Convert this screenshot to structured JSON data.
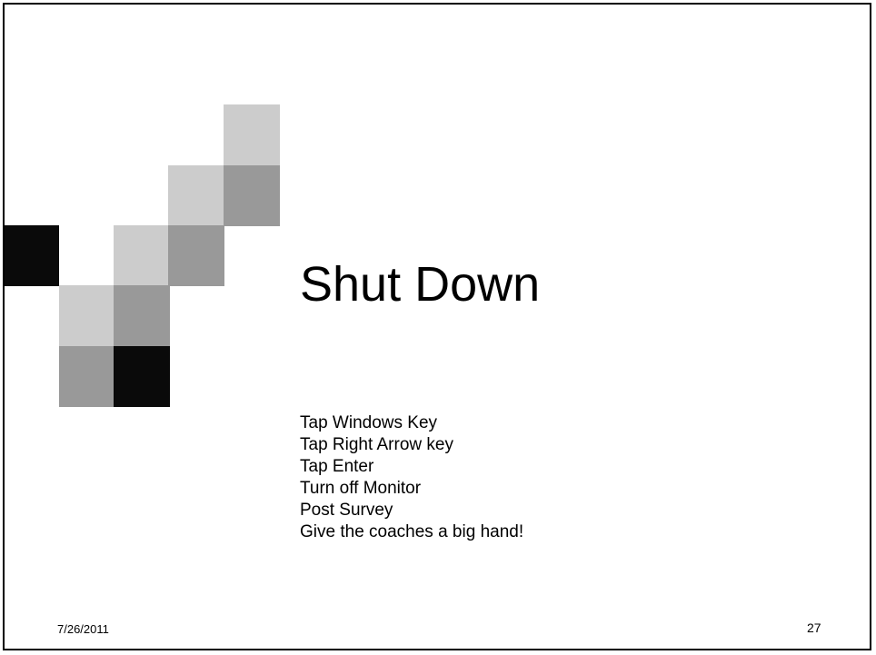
{
  "slide": {
    "title": "Shut Down",
    "bullets": [
      "Tap Windows Key",
      "Tap Right Arrow key",
      "Tap Enter",
      "Turn off Monitor",
      "Post Survey",
      "Give the coaches a big hand!"
    ],
    "footer": {
      "date": "7/26/2011",
      "page_number": "27"
    }
  },
  "colors": {
    "light_gray": "#cccccc",
    "mid_gray": "#999999",
    "black": "#0a0a0a"
  }
}
